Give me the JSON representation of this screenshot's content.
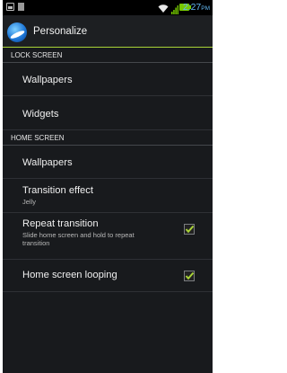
{
  "status_bar": {
    "time": "2:27",
    "ampm": "PM",
    "icons": [
      "picture-icon",
      "document-icon",
      "wifi-icon",
      "signal-icon",
      "battery-icon"
    ],
    "battery_color": "#76c900",
    "time_color": "#63b8f2"
  },
  "action_bar": {
    "title": "Personalize",
    "icon": "personalize-app-icon",
    "accent_color": "#a9d338"
  },
  "sections": {
    "lock_screen": {
      "header": "LOCK SCREEN",
      "items": [
        {
          "title": "Wallpapers"
        },
        {
          "title": "Widgets"
        }
      ]
    },
    "home_screen": {
      "header": "HOME SCREEN",
      "items": [
        {
          "title": "Wallpapers"
        },
        {
          "title": "Transition effect",
          "summary": "Jelly"
        },
        {
          "title": "Repeat transition",
          "summary": "Slide home screen and hold to repeat transition",
          "checked": true
        },
        {
          "title": "Home screen looping",
          "checked": true
        }
      ]
    }
  },
  "checkbox_color": "#a9d338"
}
